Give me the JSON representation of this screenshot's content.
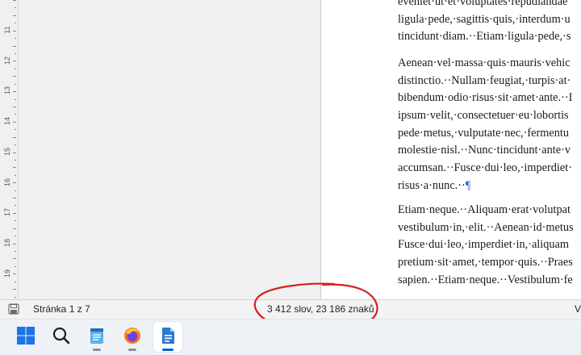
{
  "ruler": {
    "numbers": [
      "11",
      "12",
      "13",
      "14",
      "15",
      "16",
      "17",
      "18",
      "19"
    ]
  },
  "document": {
    "paragraphs": [
      {
        "lines": [
          "eveniet·ut·et·voluptates·repudiandae",
          "ligula·pede,·sagittis·quis,·interdum·u",
          "tincidunt·diam.··Etiam·ligula·pede,·s"
        ],
        "pilcrow": ""
      },
      {
        "lines": [
          "Aenean·vel·massa·quis·mauris·vehic",
          "distinctio.··Nullam·feugiat,·turpis·at·",
          "bibendum·odio·risus·sit·amet·ante.··I",
          "ipsum·velit,·consectetuer·eu·lobortis",
          "pede·metus,·vulputate·nec,·fermentu",
          "molestie·nisl.··Nunc·tincidunt·ante·v",
          "accumsan.··Fusce·dui·leo,·imperdiet·",
          "risus·a·nunc.··"
        ],
        "pilcrow": "¶"
      },
      {
        "lines": [
          "Etiam·neque.··Aliquam·erat·volutpat",
          "vestibulum·in,·elit.··Aenean·id·metus",
          "Fusce·dui·leo,·imperdiet·in,·aliquam",
          "pretium·sit·amet,·tempor·quis.··Praes",
          "sapien.··Etiam·neque.··Vestibulum·fe"
        ],
        "pilcrow": ""
      }
    ]
  },
  "statusbar": {
    "page_info": "Stránka 1 z 7",
    "word_count": "3 412 slov, 23 186 znaků",
    "right_label": "V",
    "annotation_color": "#d42020"
  },
  "taskbar": {
    "items": [
      {
        "name": "start-button",
        "icon": "windows-logo-icon",
        "active": false,
        "running": false
      },
      {
        "name": "search-button",
        "icon": "search-icon",
        "active": false,
        "running": false
      },
      {
        "name": "notepad-button",
        "icon": "notepad-icon",
        "active": false,
        "running": true
      },
      {
        "name": "firefox-button",
        "icon": "firefox-icon",
        "active": false,
        "running": true
      },
      {
        "name": "writer-button",
        "icon": "libreoffice-writer-icon",
        "active": true,
        "running": true
      }
    ]
  }
}
